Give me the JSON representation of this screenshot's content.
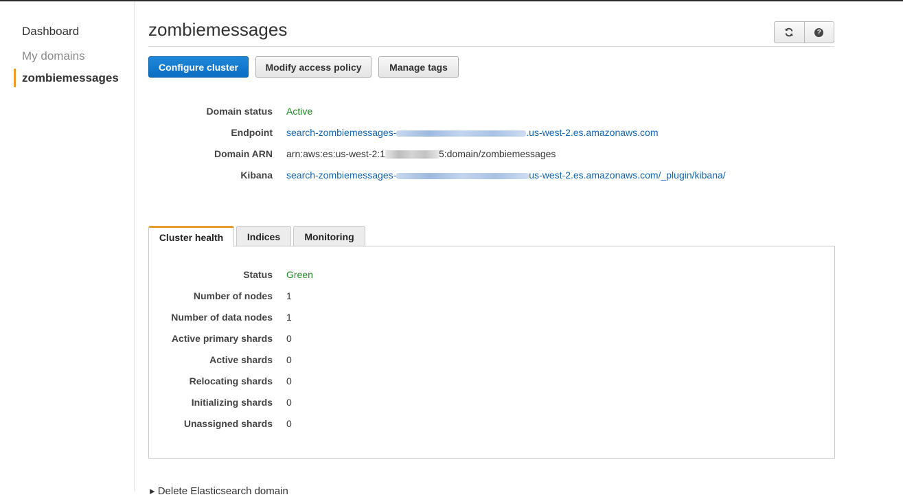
{
  "sidebar": {
    "dashboard": "Dashboard",
    "my_domains": "My domains",
    "active_domain": "zombiemessages"
  },
  "header": {
    "title": "zombiemessages",
    "refresh_icon": "refresh-icon",
    "help_icon": "help-icon",
    "help_glyph": "?"
  },
  "actions": {
    "configure": "Configure cluster",
    "modify_policy": "Modify access policy",
    "manage_tags": "Manage tags"
  },
  "overview": {
    "domain_status_label": "Domain status",
    "domain_status_value": "Active",
    "endpoint_label": "Endpoint",
    "endpoint_prefix": "search-zombiemessages-",
    "endpoint_suffix": ".us-west-2.es.amazonaws.com",
    "arn_label": "Domain ARN",
    "arn_prefix": "arn:aws:es:us-west-2:",
    "arn_mid": "1",
    "arn_suffix": "5:domain/zombiemessages",
    "kibana_label": "Kibana",
    "kibana_prefix": "search-zombiemessages-",
    "kibana_suffix": "us-west-2.es.amazonaws.com/_plugin/kibana/"
  },
  "tabs": [
    "Cluster health",
    "Indices",
    "Monitoring"
  ],
  "cluster_health": [
    {
      "label": "Status",
      "value": "Green"
    },
    {
      "label": "Number of nodes",
      "value": "1"
    },
    {
      "label": "Number of data nodes",
      "value": "1"
    },
    {
      "label": "Active primary shards",
      "value": "0"
    },
    {
      "label": "Active shards",
      "value": "0"
    },
    {
      "label": "Relocating shards",
      "value": "0"
    },
    {
      "label": "Initializing shards",
      "value": "0"
    },
    {
      "label": "Unassigned shards",
      "value": "0"
    }
  ],
  "footer": {
    "delete_text": "▸ Delete Elasticsearch domain"
  },
  "colors": {
    "accent": "#ec9b2a",
    "primary_button": "#0a6ec2",
    "status_green": "#1d8b1d",
    "link": "#0d64b8"
  }
}
